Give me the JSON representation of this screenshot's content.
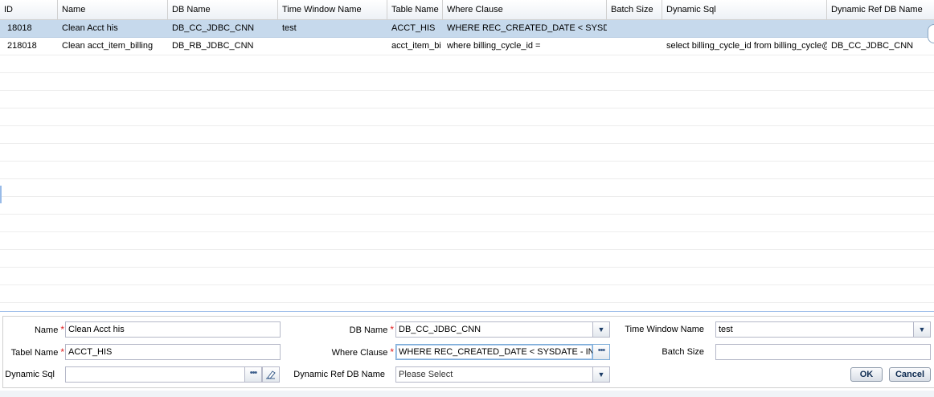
{
  "grid": {
    "columns": [
      {
        "key": "id",
        "label": "ID"
      },
      {
        "key": "name",
        "label": "Name"
      },
      {
        "key": "db_name",
        "label": "DB Name"
      },
      {
        "key": "time_window",
        "label": "Time Window Name"
      },
      {
        "key": "table_name",
        "label": "Table Name"
      },
      {
        "key": "where",
        "label": "Where Clause"
      },
      {
        "key": "batch",
        "label": "Batch Size"
      },
      {
        "key": "dyn_sql",
        "label": "Dynamic Sql"
      },
      {
        "key": "dyn_ref",
        "label": "Dynamic Ref DB Name"
      }
    ],
    "rows": [
      {
        "id": "18018",
        "name": "Clean Acct his",
        "db_name": "DB_CC_JDBC_CNN",
        "time_window": "test",
        "table_name": "ACCT_HIS",
        "where": "WHERE REC_CREATED_DATE < SYSDATE",
        "batch": "",
        "dyn_sql": "",
        "dyn_ref": "",
        "selected": true
      },
      {
        "id": "218018",
        "name": "Clean acct_item_billing",
        "db_name": "DB_RB_JDBC_CNN",
        "time_window": "",
        "table_name": "acct_item_bi",
        "where": "where billing_cycle_id =",
        "batch": "",
        "dyn_sql": "select billing_cycle_id from billing_cycle@l",
        "dyn_ref": "DB_CC_JDBC_CNN",
        "selected": false
      }
    ]
  },
  "form": {
    "name_label": "Name",
    "name_value": "Clean Acct his",
    "table_label": "Tabel Name",
    "table_value": "ACCT_HIS",
    "dynsql_label": "Dynamic Sql",
    "dynsql_value": "",
    "dbname_label": "DB Name",
    "dbname_value": "DB_CC_JDBC_CNN",
    "where_label": "Where Clause",
    "where_value": "WHERE REC_CREATED_DATE < SYSDATE - INTER",
    "dynref_label": "Dynamic Ref DB Name",
    "dynref_placeholder": "Please Select",
    "timewin_label": "Time Window Name",
    "timewin_value": "test",
    "batch_label": "Batch Size",
    "batch_value": "",
    "required_mark": "*",
    "ok_label": "OK",
    "cancel_label": "Cancel"
  },
  "icons": {
    "trigger": "chevron-down-icon",
    "ellipsis": "ellipsis-icon",
    "eraser": "eraser-icon"
  }
}
